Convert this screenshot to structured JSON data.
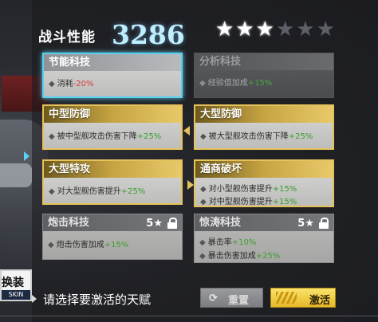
{
  "header": {
    "power_label": "战斗性能",
    "power_value": "3286",
    "stars_filled": 3,
    "stars_total": 6
  },
  "talents": [
    {
      "id": "energy",
      "title": "节能科技",
      "state": "selected",
      "lines": [
        {
          "text": "消耗",
          "value": "-20%",
          "value_color": "red"
        }
      ]
    },
    {
      "id": "analysis",
      "title": "分析科技",
      "state": "dark",
      "lines": [
        {
          "text": "经验值加成",
          "value": "+15%",
          "value_color": "green"
        }
      ]
    },
    {
      "id": "mid-defense",
      "title": "中型防御",
      "state": "gold",
      "lines": [
        {
          "text": "被中型舰攻击伤害下降",
          "value": "+25%",
          "value_color": "green"
        }
      ]
    },
    {
      "id": "large-defense",
      "title": "大型防御",
      "state": "gold",
      "lines": [
        {
          "text": "被大型舰攻击伤害下降",
          "value": "+25%",
          "value_color": "green"
        }
      ]
    },
    {
      "id": "large-attack",
      "title": "大型特攻",
      "state": "gold",
      "lines": [
        {
          "text": "对大型舰伤害提升",
          "value": "+25%",
          "value_color": "green"
        }
      ]
    },
    {
      "id": "pierce",
      "title": "通商破坏",
      "state": "gold",
      "lines": [
        {
          "text": "对小型舰伤害提升",
          "value": "+15%",
          "value_color": "green"
        },
        {
          "text": "对中型舰伤害提升",
          "value": "+15%",
          "value_color": "green"
        }
      ]
    },
    {
      "id": "cannon",
      "title": "炮击科技",
      "state": "locked",
      "requirement": "5★",
      "lines": [
        {
          "text": "炮击伤害加成",
          "value": "+15%",
          "value_color": "green"
        }
      ]
    },
    {
      "id": "storm",
      "title": "惊涛科技",
      "state": "locked",
      "requirement": "5★",
      "lines": [
        {
          "text": "暴击率",
          "value": "+10%",
          "value_color": "green"
        },
        {
          "text": "暴击伤害加成",
          "value": "+25%",
          "value_color": "green"
        }
      ]
    }
  ],
  "skin_badge": {
    "label": "换装",
    "sub": "SKIN"
  },
  "footer": {
    "hint": "请选择要激活的天赋",
    "reset_label": "重置",
    "activate_label": "激活"
  },
  "colors": {
    "accent_cyan": "#5ad0ef",
    "gold": "#e6c25a",
    "bonus_green": "#3b9e2e",
    "penalty_red": "#d43c3c",
    "power_value": "#bfeeff"
  }
}
